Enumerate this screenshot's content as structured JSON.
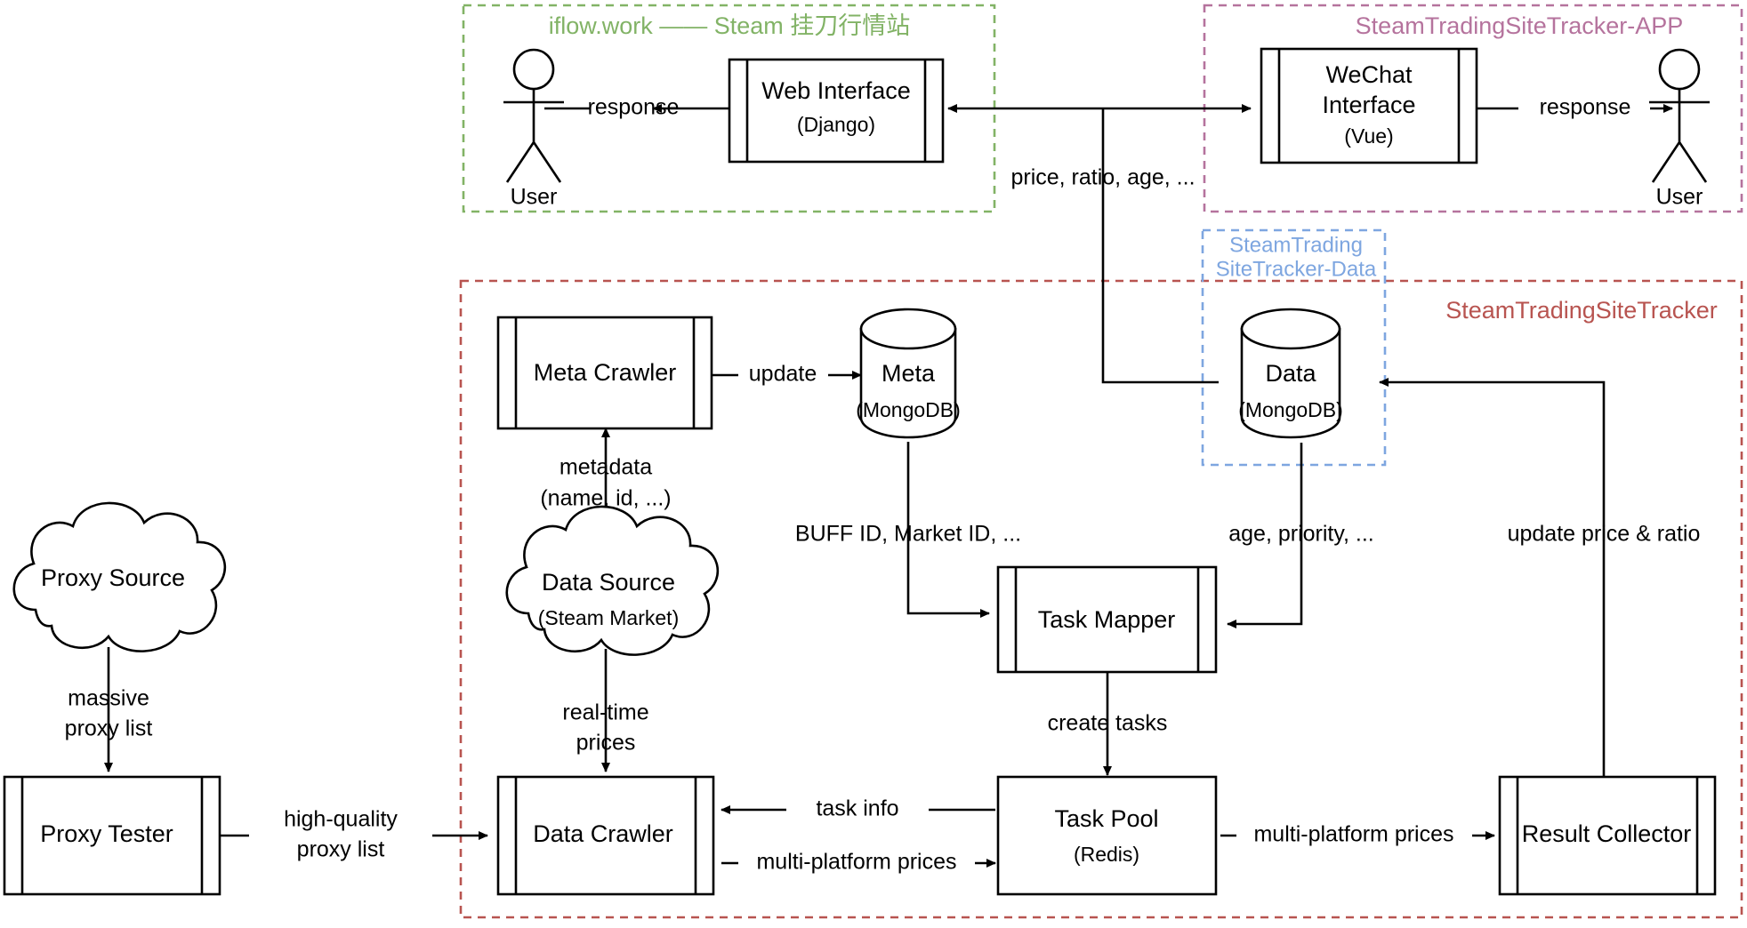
{
  "diagram": {
    "title": "SteamTradingSiteTracker architecture",
    "colors": {
      "green": "#82b366",
      "pink": "#b5739d",
      "red": "#b85450",
      "blue": "#7ea6e0",
      "line": "#000000",
      "background": "#ffffff"
    }
  },
  "groups": {
    "web": {
      "label": "iflow.work —— Steam 挂刀行情站",
      "color": "#82b366"
    },
    "app": {
      "label": "SteamTradingSiteTracker-APP",
      "color": "#b5739d"
    },
    "data": {
      "label_line1": "SteamTrading",
      "label_line2": "SiteTracker-Data",
      "color": "#7ea6e0"
    },
    "tracker": {
      "label": "SteamTradingSiteTracker",
      "color": "#b85450"
    }
  },
  "actors": {
    "left_user": "User",
    "right_user": "User"
  },
  "nodes": {
    "web_interface": {
      "title": "Web Interface",
      "subtitle": "(Django)"
    },
    "wechat_interface": {
      "title_line1": "WeChat",
      "title_line2": "Interface",
      "subtitle": "(Vue)"
    },
    "meta_crawler": {
      "title": "Meta Crawler",
      "subtitle": ""
    },
    "meta_db": {
      "title": "Meta",
      "subtitle": "(MongoDB)"
    },
    "data_db": {
      "title": "Data",
      "subtitle": "(MongoDB)"
    },
    "proxy_source": {
      "title": "Proxy Source",
      "subtitle": ""
    },
    "data_source": {
      "title": "Data Source",
      "subtitle": "(Steam Market)"
    },
    "task_mapper": {
      "title": "Task Mapper",
      "subtitle": ""
    },
    "proxy_tester": {
      "title": "Proxy Tester",
      "subtitle": ""
    },
    "data_crawler": {
      "title": "Data Crawler",
      "subtitle": ""
    },
    "task_pool": {
      "title": "Task Pool",
      "subtitle": "(Redis)"
    },
    "result_collector": {
      "title": "Result Collector",
      "subtitle": ""
    }
  },
  "edge_labels": {
    "response_left": "response",
    "response_right": "response",
    "price_ratio_age": "price, ratio, age, ...",
    "update": "update",
    "metadata_line1": "metadata",
    "metadata_line2": "(name, id, ...)",
    "buff_market_id": "BUFF ID, Market ID, ...",
    "age_priority": "age, priority, ...",
    "update_price_ratio": "update price & ratio",
    "massive_proxy_line1": "massive",
    "massive_proxy_line2": "proxy list",
    "realtime_prices_line1": "real-time",
    "realtime_prices_line2": "prices",
    "high_quality_line1": "high-quality",
    "high_quality_line2": "proxy list",
    "create_tasks": "create tasks",
    "task_info": "task info",
    "multi_platform_prices_left": "multi-platform prices",
    "multi_platform_prices_right": "multi-platform prices"
  }
}
